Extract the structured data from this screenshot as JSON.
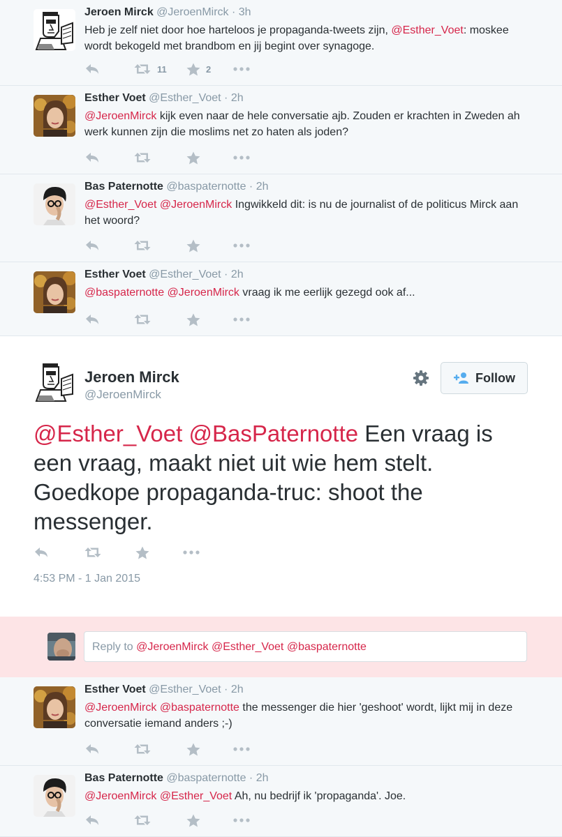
{
  "thread": [
    {
      "name": "Jeroen Mirck",
      "handle": "@JeroenMirck",
      "time": "3h",
      "text_parts": [
        {
          "t": "Heb je zelf niet door hoe harteloos je propaganda-tweets zijn, "
        },
        {
          "t": "@Esther_Voet",
          "m": true
        },
        {
          "t": ": moskee wordt bekogeld met brandbom en jij begint over synagoge."
        }
      ],
      "retweets": "11",
      "favorites": "2",
      "avatar": "cartoon"
    },
    {
      "name": "Esther Voet",
      "handle": "@Esther_Voet",
      "time": "2h",
      "text_parts": [
        {
          "t": "@JeroenMirck",
          "m": true
        },
        {
          "t": " kijk even naar de hele conversatie ajb. Zouden er krachten in Zweden ah werk kunnen zijn die moslims net zo haten als joden?"
        }
      ],
      "retweets": "",
      "favorites": "",
      "avatar": "woman"
    },
    {
      "name": "Bas Paternotte",
      "handle": "@baspaternotte",
      "time": "2h",
      "text_parts": [
        {
          "t": "@Esther_Voet",
          "m": true
        },
        {
          "t": " "
        },
        {
          "t": "@JeroenMirck",
          "m": true
        },
        {
          "t": " Ingwikkeld dit: is nu de journalist of de politicus Mirck aan het woord?"
        }
      ],
      "retweets": "",
      "favorites": "",
      "avatar": "man"
    },
    {
      "name": "Esther Voet",
      "handle": "@Esther_Voet",
      "time": "2h",
      "text_parts": [
        {
          "t": "@baspaternotte",
          "m": true
        },
        {
          "t": " "
        },
        {
          "t": "@JeroenMirck",
          "m": true
        },
        {
          "t": " vraag ik me eerlijk gezegd ook af..."
        }
      ],
      "retweets": "",
      "favorites": "",
      "avatar": "woman"
    }
  ],
  "main": {
    "name": "Jeroen Mirck",
    "handle": "@JeroenMirck",
    "follow_label": "Follow",
    "text_parts": [
      {
        "t": "@Esther_Voet",
        "m": true
      },
      {
        "t": " "
      },
      {
        "t": "@BasPaternotte",
        "m": true
      },
      {
        "t": " Een vraag is een vraag, maakt niet uit wie hem stelt. Goedkope propaganda-truc: shoot the messenger."
      }
    ],
    "timestamp": "4:53 PM - 1 Jan 2015"
  },
  "reply": {
    "prefix": "Reply to ",
    "mentions": "@JeroenMirck @Esther_Voet @baspaternotte"
  },
  "replies": [
    {
      "name": "Esther Voet",
      "handle": "@Esther_Voet",
      "time": "2h",
      "text_parts": [
        {
          "t": "@JeroenMirck",
          "m": true
        },
        {
          "t": " "
        },
        {
          "t": "@baspaternotte",
          "m": true
        },
        {
          "t": " the messenger die hier 'geshoot' wordt, lijkt mij in deze conversatie iemand anders ;-)"
        }
      ],
      "retweets": "",
      "favorites": "",
      "avatar": "woman"
    },
    {
      "name": "Bas Paternotte",
      "handle": "@baspaternotte",
      "time": "2h",
      "text_parts": [
        {
          "t": "@JeroenMirck",
          "m": true
        },
        {
          "t": " "
        },
        {
          "t": "@Esther_Voet",
          "m": true
        },
        {
          "t": " Ah, nu bedrijf ik 'propaganda'. Joe."
        }
      ],
      "retweets": "",
      "favorites": "",
      "avatar": "man"
    }
  ],
  "colors": {
    "mention": "#d6264a",
    "muted": "#8899a6",
    "thread_bg": "#f5f8fa",
    "reply_bg": "#fde4e6"
  }
}
